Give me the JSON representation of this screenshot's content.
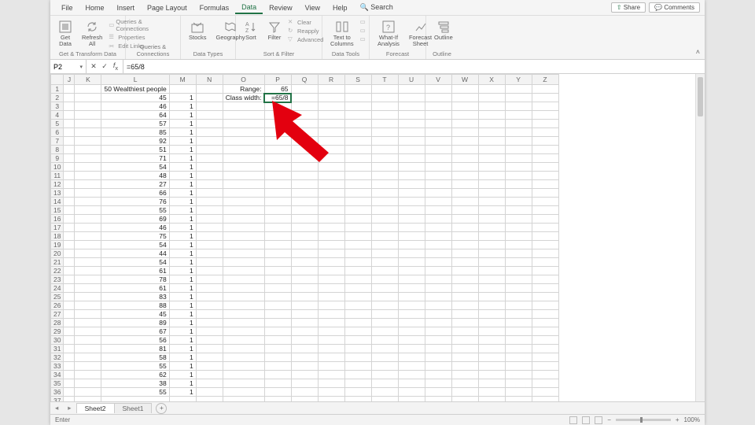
{
  "menu": {
    "tabs": [
      "File",
      "Home",
      "Insert",
      "Page Layout",
      "Formulas",
      "Data",
      "Review",
      "View",
      "Help"
    ],
    "active": "Data",
    "search_label": "Search",
    "share": "Share",
    "comments": "Comments"
  },
  "ribbon": {
    "groups": [
      {
        "label": "Get & Transform Data",
        "items": [
          "Get Data",
          "Refresh All"
        ],
        "minis": [
          "Queries & Connections",
          "Properties",
          "Edit Links"
        ]
      },
      {
        "label": "Queries & Connections"
      },
      {
        "label": "Data Types",
        "items": [
          "Stocks",
          "Geography"
        ]
      },
      {
        "label": "Sort & Filter",
        "items": [
          "Sort",
          "Filter"
        ],
        "minis": [
          "Clear",
          "Reapply",
          "Advanced"
        ]
      },
      {
        "label": "Data Tools",
        "items": [
          "Text to Columns"
        ]
      },
      {
        "label": "Forecast",
        "items": [
          "What-If Analysis",
          "Forecast Sheet"
        ]
      },
      {
        "label": "Outline",
        "items": [
          "Outline"
        ]
      }
    ]
  },
  "formula_bar": {
    "name_box": "P2",
    "formula": "=65/8"
  },
  "columns": [
    "J",
    "K",
    "L",
    "M",
    "N",
    "O",
    "P",
    "Q",
    "R",
    "S",
    "T",
    "U",
    "V",
    "W",
    "X",
    "Y",
    "Z"
  ],
  "header_row": {
    "L": "50 Wealthiest people",
    "O": "Range:",
    "P": "65"
  },
  "class_width_row": {
    "O": "Class width:",
    "P": "=65/8"
  },
  "data_L": [
    45,
    46,
    64,
    57,
    85,
    92,
    51,
    71,
    54,
    48,
    27,
    66,
    76,
    55,
    69,
    46,
    75,
    54,
    44,
    54,
    61,
    78,
    61,
    83,
    88,
    45,
    89,
    67,
    56,
    81,
    58,
    55,
    62,
    38,
    55
  ],
  "data_M_value": 1,
  "sheet_tabs": {
    "active": "Sheet2",
    "others": [
      "Sheet1"
    ]
  },
  "status": {
    "mode": "Enter",
    "zoom": "100%"
  }
}
